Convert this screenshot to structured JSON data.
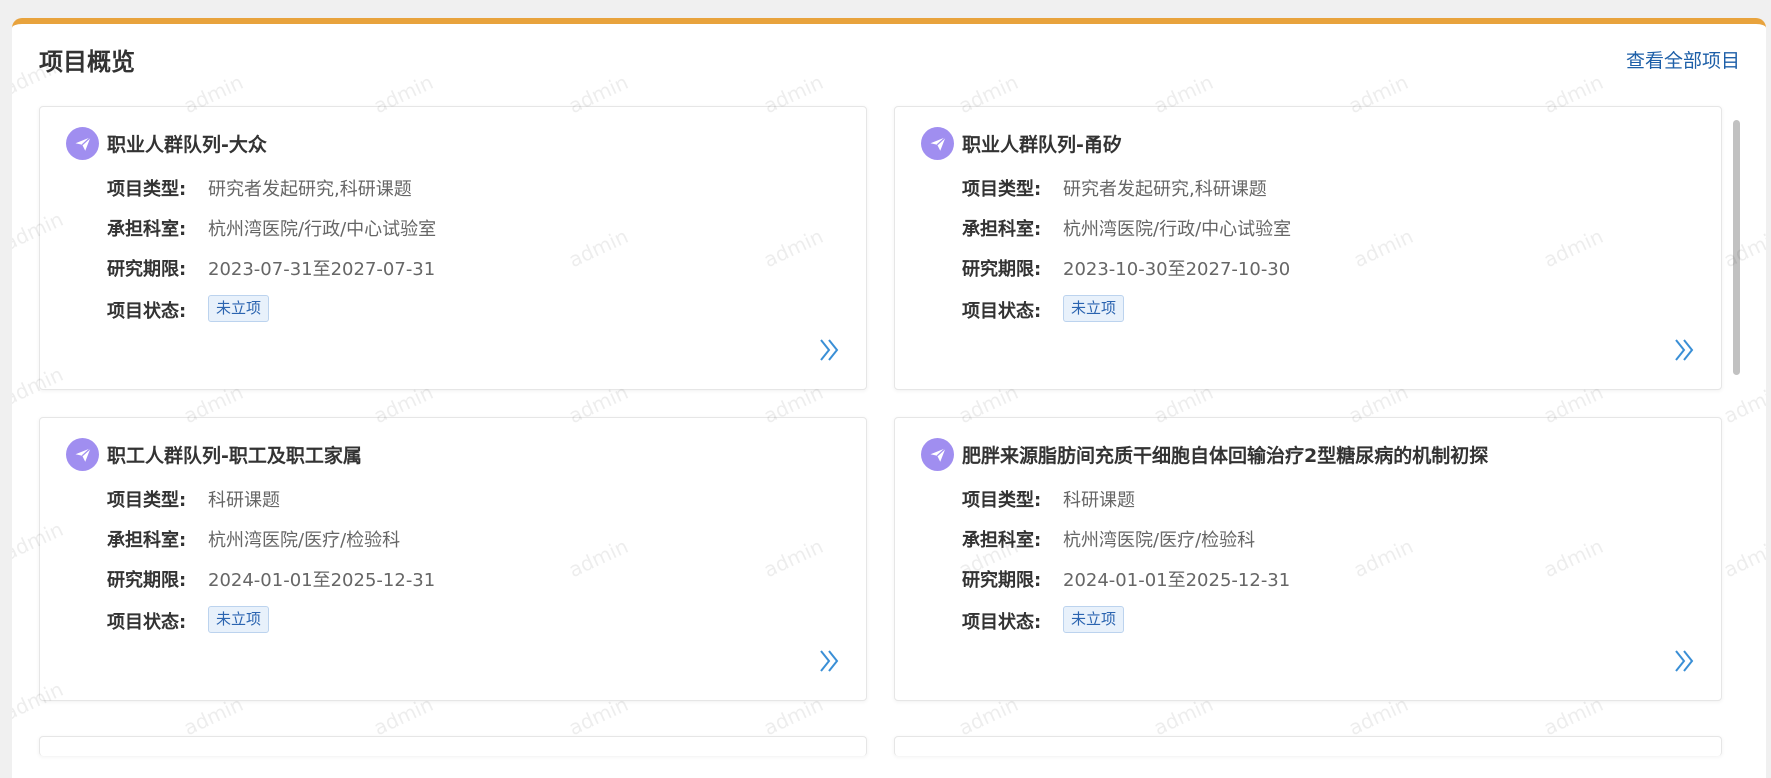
{
  "panel": {
    "title": "项目概览",
    "view_all_label": "查看全部项目"
  },
  "watermark_text": "admin",
  "labels": {
    "type": "项目类型:",
    "dept": "承担科室:",
    "period": "研究期限:",
    "status": "项目状态:"
  },
  "projects": [
    {
      "title": "职业人群队列-大众",
      "type": "研究者发起研究,科研课题",
      "dept": "杭州湾医院/行政/中心试验室",
      "period": "2023-07-31至2027-07-31",
      "status": "未立项"
    },
    {
      "title": "职业人群队列-甬矽",
      "type": "研究者发起研究,科研课题",
      "dept": "杭州湾医院/行政/中心试验室",
      "period": "2023-10-30至2027-10-30",
      "status": "未立项"
    },
    {
      "title": "职工人群队列-职工及职工家属",
      "type": "科研课题",
      "dept": "杭州湾医院/医疗/检验科",
      "period": "2024-01-01至2025-12-31",
      "status": "未立项"
    },
    {
      "title": "肥胖来源脂肪间充质干细胞自体回输治疗2型糖尿病的机制初探",
      "type": "科研课题",
      "dept": "杭州湾医院/医疗/检验科",
      "period": "2024-01-01至2025-12-31",
      "status": "未立项"
    }
  ],
  "colors": {
    "accent_bar": "#e8a33d",
    "link": "#1d5fa8",
    "icon_bg": "#a08ef0",
    "tag_text": "#2b64b0",
    "chevron": "#3a8fd6"
  },
  "icons": {
    "project": "paper-plane-icon",
    "more": "double-chevron-right-icon"
  }
}
